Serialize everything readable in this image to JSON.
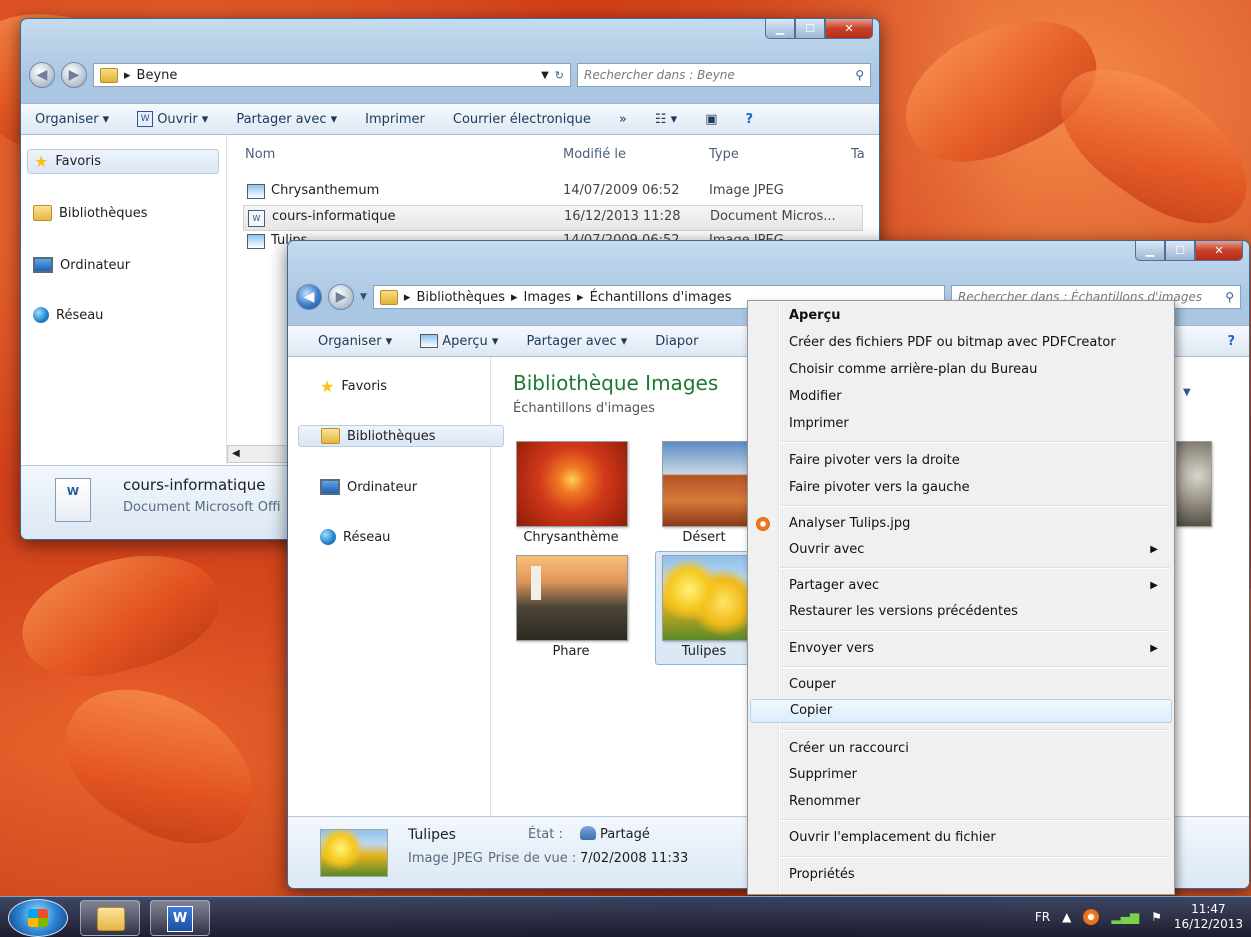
{
  "back_window": {
    "address": "Beyne",
    "search_placeholder": "Rechercher dans : Beyne",
    "toolbar": {
      "organiser": "Organiser ▾",
      "ouvrir": "Ouvrir ▾",
      "partager": "Partager avec ▾",
      "imprimer": "Imprimer",
      "courrier": "Courrier électronique",
      "more": "»"
    },
    "nav": {
      "favoris": "Favoris",
      "bibliotheques": "Bibliothèques",
      "ordinateur": "Ordinateur",
      "reseau": "Réseau"
    },
    "columns": {
      "nom": "Nom",
      "modifie": "Modifié le",
      "type": "Type",
      "taille": "Ta"
    },
    "files": [
      {
        "name": "Chrysanthemum",
        "date": "14/07/2009 06:52",
        "type": "Image JPEG"
      },
      {
        "name": "cours-informatique",
        "date": "16/12/2013 11:28",
        "type": "Document Micros..."
      },
      {
        "name": "Tulips",
        "date": "14/07/2009 06:52",
        "type": "Image JPEG"
      }
    ],
    "details": {
      "name": "cours-informatique",
      "type": "Document Microsoft Offi"
    }
  },
  "front_window": {
    "breadcrumb": [
      "Bibliothèques",
      "Images",
      "Échantillons d'images"
    ],
    "search_placeholder": "Rechercher dans : Échantillons d'images",
    "toolbar": {
      "organiser": "Organiser ▾",
      "apercu": "Aperçu ▾",
      "partager": "Partager avec ▾",
      "diapo": "Diapor"
    },
    "nav": {
      "favoris": "Favoris",
      "bibliotheques": "Bibliothèques",
      "ordinateur": "Ordinateur",
      "reseau": "Réseau"
    },
    "library_title": "Bibliothèque Images",
    "library_subtitle": "Échantillons d'images",
    "thumbnails": [
      "Chrysanthème",
      "Désert",
      "Phare",
      "Tulipes"
    ],
    "details": {
      "name": "Tulipes",
      "type": "Image JPEG",
      "state_label": "État :",
      "state_value": "Partagé",
      "date_label": "Prise de vue :",
      "date_value": "7/02/2008 11:33"
    }
  },
  "context_menu": {
    "items": [
      "Aperçu",
      "Créer des fichiers PDF ou bitmap avec PDFCreator",
      "Choisir comme arrière-plan du Bureau",
      "Modifier",
      "Imprimer",
      "Faire pivoter vers la droite",
      "Faire pivoter vers la gauche",
      "Analyser Tulips.jpg",
      "Ouvrir avec",
      "Partager avec",
      "Restaurer les versions précédentes",
      "Envoyer vers",
      "Couper",
      "Copier",
      "Créer un raccourci",
      "Supprimer",
      "Renommer",
      "Ouvrir l'emplacement du fichier",
      "Propriétés"
    ]
  },
  "taskbar": {
    "lang": "FR",
    "time": "11:47",
    "date": "16/12/2013"
  }
}
